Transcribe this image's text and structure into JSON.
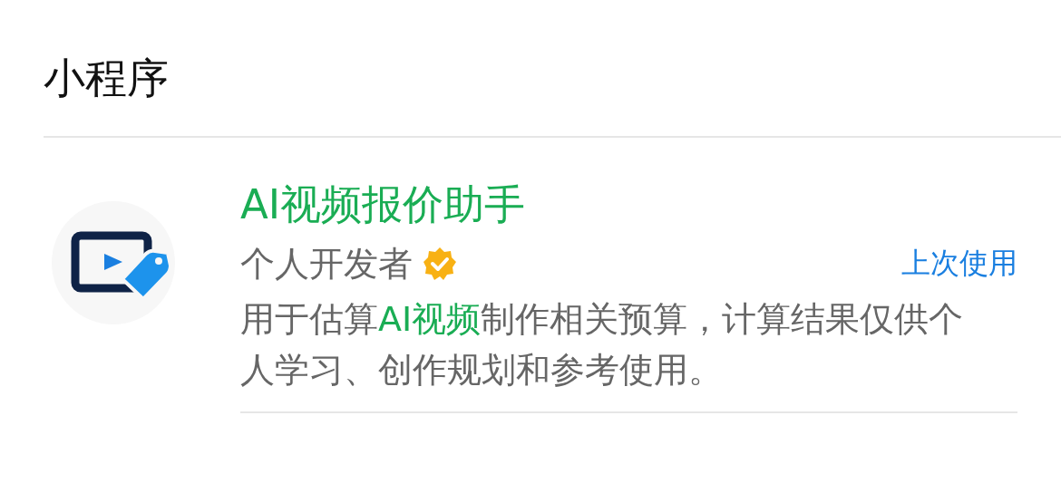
{
  "section": {
    "title": "小程序"
  },
  "mini_program": {
    "name": "AI视频报价助手",
    "developer": "个人开发者",
    "verified": true,
    "recent_label": "上次使用",
    "description": [
      {
        "text": "用于估算",
        "highlight": false
      },
      {
        "text": "AI视频",
        "highlight": true
      },
      {
        "text": "制作相关预算，计算结果仅供个人学习、创作规划和参考使用。",
        "highlight": false
      }
    ]
  }
}
